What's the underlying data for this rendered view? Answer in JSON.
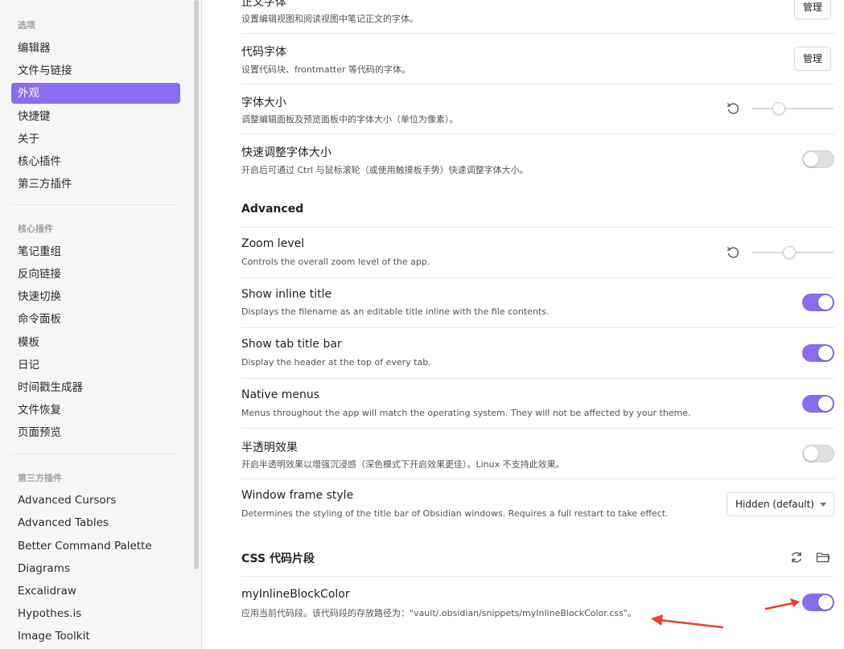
{
  "sidebar": {
    "options_heading": "选项",
    "options": [
      "编辑器",
      "文件与链接",
      "外观",
      "快捷键",
      "关于",
      "核心插件",
      "第三方插件"
    ],
    "core_heading": "核心插件",
    "core": [
      "笔记重组",
      "反向链接",
      "快速切换",
      "命令面板",
      "模板",
      "日记",
      "时间戳生成器",
      "文件恢复",
      "页面预览"
    ],
    "third_heading": "第三方插件",
    "third": [
      "Advanced Cursors",
      "Advanced Tables",
      "Better Command Palette",
      "Diagrams",
      "Excalidraw",
      "Hypothes.is",
      "Image Toolkit"
    ]
  },
  "main": {
    "text_font": {
      "title": "正文字体",
      "desc": "设置编辑视图和阅读视图中笔记正文的字体。",
      "button": "管理"
    },
    "code_font": {
      "title": "代码字体",
      "desc": "设置代码块、frontmatter 等代码的字体。",
      "button": "管理"
    },
    "font_size": {
      "title": "字体大小",
      "desc": "调整编辑面板及预览面板中的字体大小（单位为像素）。",
      "value": 0.3
    },
    "quick_font": {
      "title": "快速调整字体大小",
      "desc": "开启后可通过 Ctrl 与鼠标滚轮（或使用触摸板手势）快速调整字体大小。",
      "enabled": false
    },
    "advanced_heading": "Advanced",
    "zoom": {
      "title": "Zoom level",
      "desc": "Controls the overall zoom level of the app.",
      "value": 0.45
    },
    "inline_title": {
      "title": "Show inline title",
      "desc": "Displays the filename as an editable title inline with the file contents.",
      "enabled": true
    },
    "tab_title": {
      "title": "Show tab title bar",
      "desc": "Display the header at the top of every tab.",
      "enabled": true
    },
    "native_menus": {
      "title": "Native menus",
      "desc": "Menus throughout the app will match the operating system. They will not be affected by your theme.",
      "enabled": true
    },
    "translucent": {
      "title": "半透明效果",
      "desc": "开启半透明效果以增强沉浸感（深色模式下开启效果更佳）。Linux 不支持此效果。",
      "enabled": false
    },
    "frame_style": {
      "title": "Window frame style",
      "desc": "Determines the styling of the title bar of Obsidian windows. Requires a full restart to take effect.",
      "selected": "Hidden (default)"
    },
    "css_heading": "CSS 代码片段",
    "snippet": {
      "title": "myInlineBlockColor",
      "desc": "应用当前代码段。该代码段的存放路径为：\"vault/.obsidian/snippets/myInlineBlockColor.css\"。",
      "enabled": true
    }
  },
  "colors": {
    "accent": "#8b6cef",
    "annotation_arrow": "#e8412b"
  }
}
